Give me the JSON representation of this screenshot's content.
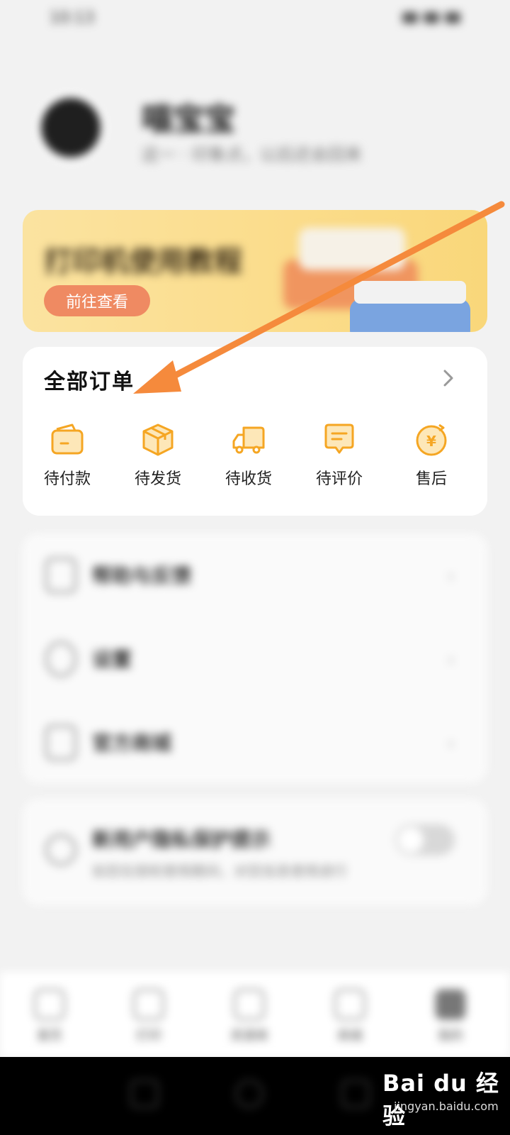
{
  "status_bar": {
    "time": "10:13"
  },
  "profile": {
    "name": "喵宝宝",
    "subtitle": "这一 · 印象点，以后还会回来"
  },
  "banner": {
    "title": "打印机使用教程",
    "button_label": "前往查看"
  },
  "orders": {
    "title": "全部订单",
    "items": [
      {
        "label": "待付款",
        "icon": "wallet-icon"
      },
      {
        "label": "待发货",
        "icon": "package-box-icon"
      },
      {
        "label": "待收货",
        "icon": "delivery-truck-icon"
      },
      {
        "label": "待评价",
        "icon": "comment-bubble-icon"
      },
      {
        "label": "售后",
        "icon": "yuan-refund-icon"
      }
    ]
  },
  "menu": {
    "items": [
      {
        "label": "帮助与反馈"
      },
      {
        "label": "设置"
      },
      {
        "label": "官方商城"
      }
    ]
  },
  "privacy": {
    "title": "新用户隐私保护提示",
    "description": "如您在授权使用期间，对您信息使用进行"
  },
  "tab_bar": {
    "items": [
      {
        "label": "首页"
      },
      {
        "label": "打印"
      },
      {
        "label": "资源库"
      },
      {
        "label": "商城"
      },
      {
        "label": "我的"
      }
    ]
  },
  "watermark": {
    "main": "Bai du 经验",
    "sub": "jingyan.baidu.com"
  },
  "colors": {
    "accent_orange": "#f5a623",
    "arrow": "#f58a3c"
  }
}
